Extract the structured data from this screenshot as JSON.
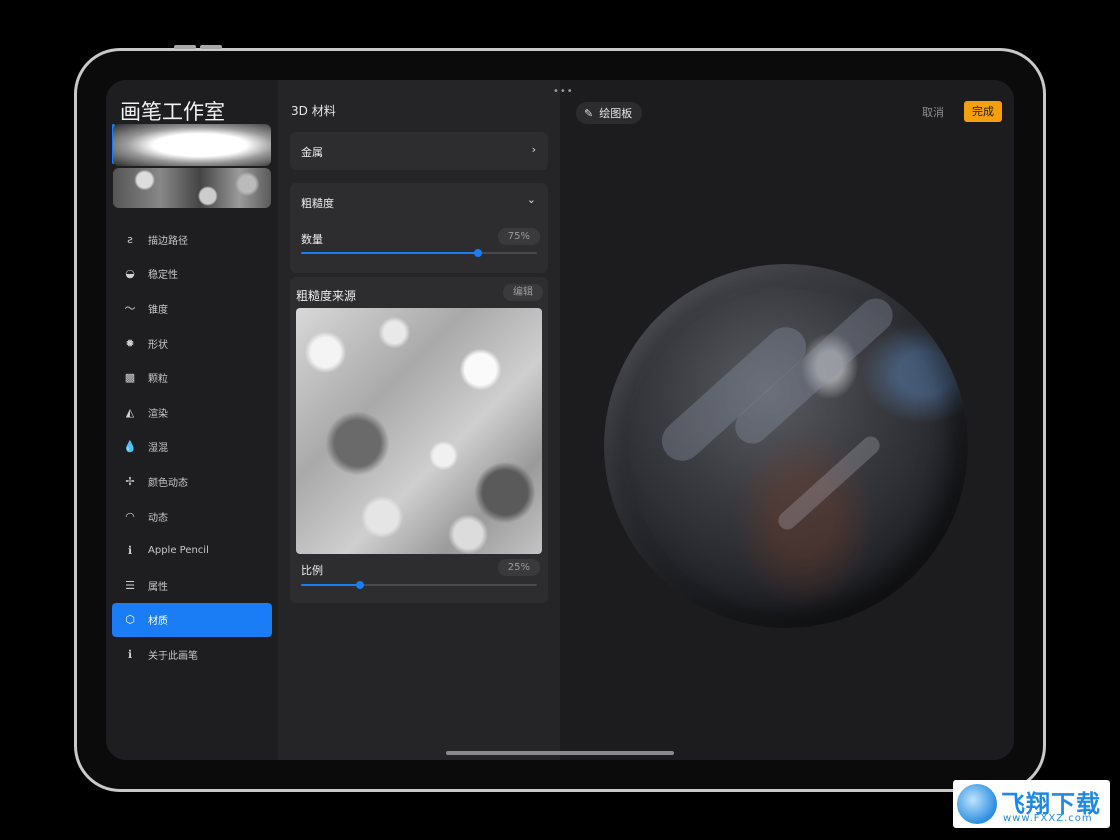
{
  "left_panel": {
    "title": "画笔工作室",
    "menu": [
      {
        "label": "描边路径",
        "icon": "stroke-path-icon",
        "glyph": "ƨ"
      },
      {
        "label": "稳定性",
        "icon": "stabilization-icon",
        "glyph": "◒"
      },
      {
        "label": "锥度",
        "icon": "taper-icon",
        "glyph": "〜"
      },
      {
        "label": "形状",
        "icon": "shape-icon",
        "glyph": "✹"
      },
      {
        "label": "颗粒",
        "icon": "grain-icon",
        "glyph": "▩"
      },
      {
        "label": "渲染",
        "icon": "rendering-icon",
        "glyph": "◭"
      },
      {
        "label": "湿混",
        "icon": "wet-mix-icon",
        "glyph": "💧"
      },
      {
        "label": "颜色动态",
        "icon": "color-dynamics-icon",
        "glyph": "✢"
      },
      {
        "label": "动态",
        "icon": "dynamics-icon",
        "glyph": "◠"
      },
      {
        "label": "Apple Pencil",
        "icon": "apple-pencil-icon",
        "glyph": "ℹ"
      },
      {
        "label": "属性",
        "icon": "properties-icon",
        "glyph": "☰"
      },
      {
        "label": "材质",
        "icon": "materials-icon",
        "glyph": "⬡"
      },
      {
        "label": "关于此画笔",
        "icon": "about-brush-icon",
        "glyph": "ℹ"
      }
    ],
    "active_index": 11
  },
  "middle_panel": {
    "heading": "3D 材料",
    "metallic": {
      "label": "金属",
      "chevron": "›"
    },
    "roughness": {
      "label": "粗糙度",
      "chevron": "⌄",
      "amount_label": "数量",
      "amount_value": "75%",
      "amount_fraction": 0.75
    },
    "roughness_source": {
      "label": "粗糙度来源",
      "edit_label": "编辑",
      "scale_label": "比例",
      "scale_value": "25%",
      "scale_fraction": 0.25
    }
  },
  "preview": {
    "canvas_button": "绘图板",
    "cancel_label": "取消",
    "done_label": "完成"
  },
  "watermark": {
    "brand": "飞翔下载",
    "url": "www.FXXZ.com"
  },
  "colors": {
    "accent": "#1a7df5",
    "done_button": "#f5a00a",
    "panel_bg": "#252527",
    "screen_bg": "#1c1c1e"
  }
}
